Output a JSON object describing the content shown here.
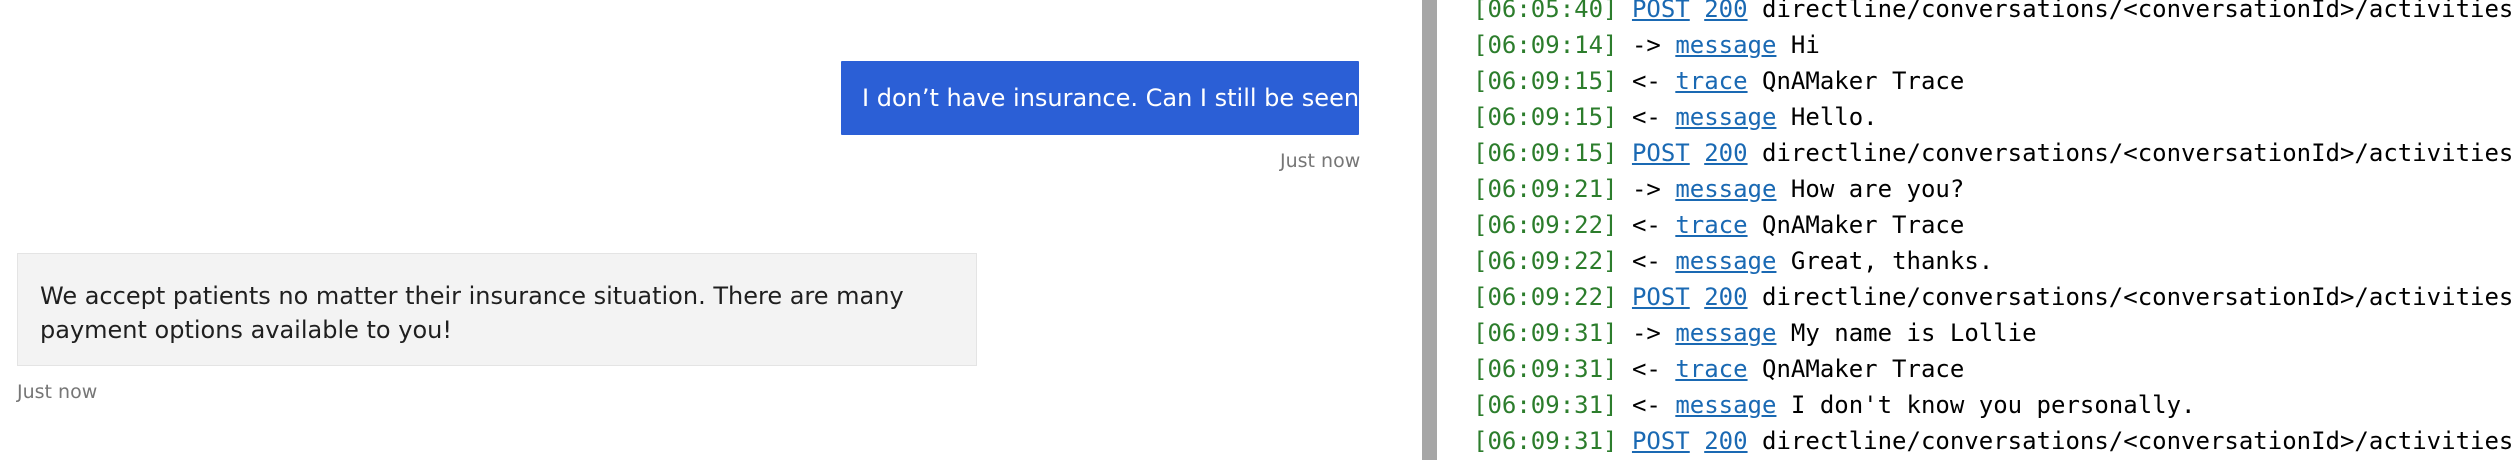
{
  "chat": {
    "user_message": "I don’t have insurance. Can I still be seen?",
    "user_timestamp": "Just now",
    "bot_message_line1": "We accept patients no matter their insurance situation. There are many",
    "bot_message_line2": "payment options available to you!",
    "bot_timestamp": "Just now"
  },
  "log": {
    "lines": [
      {
        "timestamp": "[06:05:40]",
        "method": "POST",
        "status": "200",
        "path": "directline/conversations/<conversationId>/activities"
      },
      {
        "timestamp": "[06:09:14]",
        "direction": "->",
        "type": "message",
        "text": "Hi"
      },
      {
        "timestamp": "[06:09:15]",
        "direction": "<-",
        "type": "trace",
        "text": "QnAMaker Trace"
      },
      {
        "timestamp": "[06:09:15]",
        "direction": "<-",
        "type": "message",
        "text": "Hello."
      },
      {
        "timestamp": "[06:09:15]",
        "method": "POST",
        "status": "200",
        "path": "directline/conversations/<conversationId>/activities"
      },
      {
        "timestamp": "[06:09:21]",
        "direction": "->",
        "type": "message",
        "text": "How are you?"
      },
      {
        "timestamp": "[06:09:22]",
        "direction": "<-",
        "type": "trace",
        "text": "QnAMaker Trace"
      },
      {
        "timestamp": "[06:09:22]",
        "direction": "<-",
        "type": "message",
        "text": "Great, thanks."
      },
      {
        "timestamp": "[06:09:22]",
        "method": "POST",
        "status": "200",
        "path": "directline/conversations/<conversationId>/activities"
      },
      {
        "timestamp": "[06:09:31]",
        "direction": "->",
        "type": "message",
        "text": "My name is Lollie"
      },
      {
        "timestamp": "[06:09:31]",
        "direction": "<-",
        "type": "trace",
        "text": "QnAMaker Trace"
      },
      {
        "timestamp": "[06:09:31]",
        "direction": "<-",
        "type": "message",
        "text": "I don't know you personally."
      },
      {
        "timestamp": "[06:09:31]",
        "method": "POST",
        "status": "200",
        "path": "directline/conversations/<conversationId>/activities"
      }
    ]
  },
  "colors": {
    "user_bubble": "#2b5fd6",
    "bot_bubble": "#f3f3f3",
    "timestamp_green": "#2c7d2c",
    "link_blue": "#1a69b3",
    "splitter": "#a6a6a6"
  }
}
